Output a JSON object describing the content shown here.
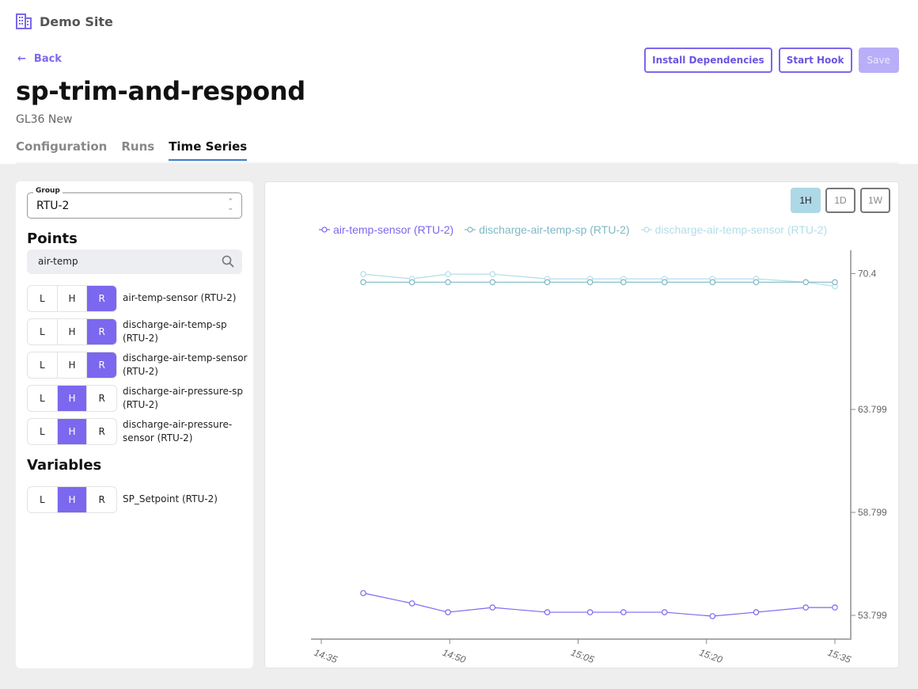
{
  "site": {
    "name": "Demo Site",
    "icon": "building-icon"
  },
  "nav": {
    "back_label": "Back",
    "back_icon": "arrow-left-icon"
  },
  "actions": {
    "install_label": "Install Dependencies",
    "start_hook_label": "Start Hook",
    "save_label": "Save"
  },
  "page": {
    "title": "sp-trim-and-respond",
    "subtitle": "GL36 New"
  },
  "tabs": [
    {
      "label": "Configuration",
      "active": false
    },
    {
      "label": "Runs",
      "active": false
    },
    {
      "label": "Time Series",
      "active": true
    }
  ],
  "sidebar": {
    "group": {
      "label": "Group",
      "value": "RTU-2"
    },
    "points_title": "Points",
    "search": {
      "value": "air-temp",
      "icon": "search-icon"
    },
    "points": [
      {
        "label": "air-temp-sensor (RTU-2)",
        "selected": "R"
      },
      {
        "label": "discharge-air-temp-sp (RTU-2)",
        "selected": "R"
      },
      {
        "label": "discharge-air-temp-sensor (RTU-2)",
        "selected": "R"
      },
      {
        "label": "discharge-air-pressure-sp (RTU-2)",
        "selected": "H"
      },
      {
        "label": "discharge-air-pressure-sensor (RTU-2)",
        "selected": "H"
      }
    ],
    "variables_title": "Variables",
    "variables": [
      {
        "label": "SP_Setpoint (RTU-2)",
        "selected": "H"
      }
    ],
    "segment_labels": [
      "L",
      "H",
      "R"
    ]
  },
  "range": {
    "options": [
      "1H",
      "1D",
      "1W"
    ],
    "active": "1H"
  },
  "chart_data": {
    "type": "line",
    "title": "",
    "xlabel": "",
    "ylabel": "",
    "x_ticks": [
      "14:35",
      "14:50",
      "15:05",
      "15:20",
      "15:35"
    ],
    "y_ticks": [
      70.4,
      63.799,
      58.799,
      53.799
    ],
    "y_axis_position": "right",
    "xlim_minutes": [
      0,
      60
    ],
    "ylim": [
      52.6,
      71.2
    ],
    "legend_position": "top",
    "grid": false,
    "x_minutes": [
      4.9,
      10.6,
      14.8,
      20.0,
      26.4,
      31.4,
      35.3,
      40.1,
      45.7,
      50.8,
      56.6,
      60.0
    ],
    "series": [
      {
        "name": "air-temp-sensor (RTU-2)",
        "color": "#7b68ee",
        "values": [
          54.88,
          54.38,
          53.95,
          54.18,
          53.95,
          53.95,
          53.95,
          53.95,
          53.76,
          53.95,
          54.18,
          54.18
        ]
      },
      {
        "name": "discharge-air-temp-sp (RTU-2)",
        "color": "#7fb8c4",
        "values": [
          69.98,
          69.98,
          69.98,
          69.98,
          69.98,
          69.98,
          69.98,
          69.98,
          69.98,
          69.98,
          69.98,
          69.98
        ]
      },
      {
        "name": "discharge-air-temp-sensor (RTU-2)",
        "color": "#b3dde8",
        "values": [
          70.37,
          70.14,
          70.37,
          70.37,
          70.14,
          70.14,
          70.14,
          70.14,
          70.14,
          70.14,
          69.98,
          69.78
        ]
      }
    ]
  }
}
